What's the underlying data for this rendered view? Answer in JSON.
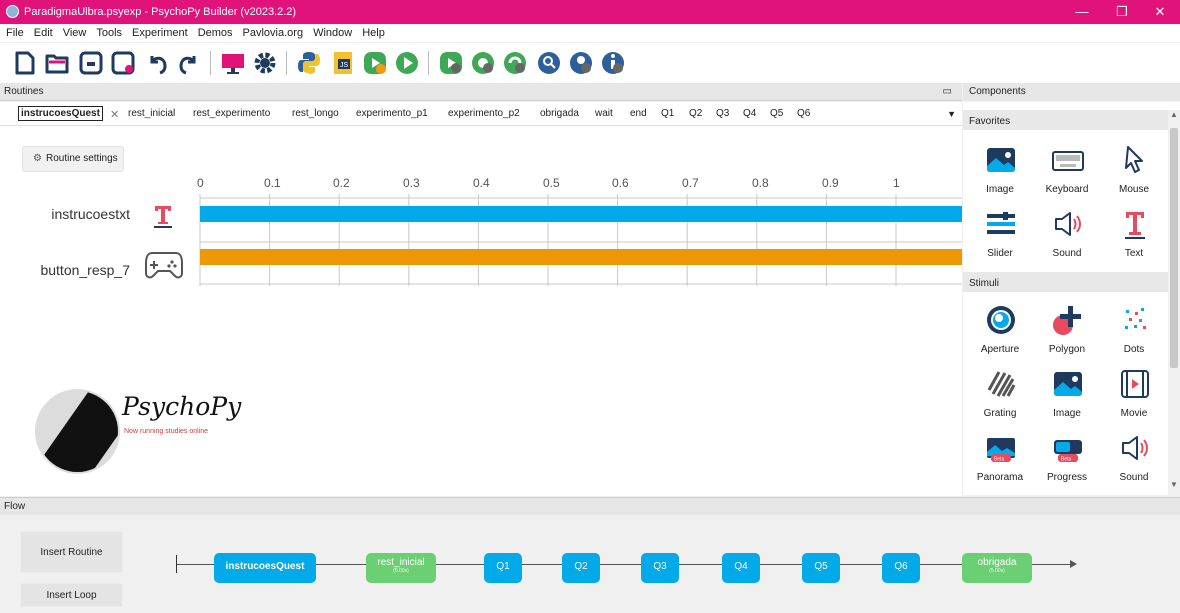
{
  "window": {
    "title": "ParadigmaUlbra.psyexp - PsychoPy Builder (v2023.2.2)",
    "controls": {
      "minimize": "—",
      "maximize": "❐",
      "close": "✕"
    },
    "colors": {
      "titlebar": "#e0137a"
    }
  },
  "menu": [
    "File",
    "Edit",
    "View",
    "Tools",
    "Experiment",
    "Demos",
    "Pavlovia.org",
    "Window",
    "Help"
  ],
  "toolbar": [
    {
      "name": "new-file-icon"
    },
    {
      "name": "open-icon"
    },
    {
      "name": "save-icon"
    },
    {
      "name": "save-as-icon"
    },
    {
      "name": "undo-icon"
    },
    {
      "name": "redo-icon"
    },
    {
      "name": "monitor-icon"
    },
    {
      "name": "settings-gear-icon"
    },
    {
      "name": "compile-python-icon"
    },
    {
      "name": "compile-js-icon"
    },
    {
      "name": "run-pilot-icon"
    },
    {
      "name": "run-icon"
    },
    {
      "name": "pavlovia-sync-icon"
    },
    {
      "name": "pavlovia-pilot-icon"
    },
    {
      "name": "pavlovia-run-icon"
    },
    {
      "name": "pavlovia-search-icon"
    },
    {
      "name": "pavlovia-user-icon"
    },
    {
      "name": "pavlovia-info-icon"
    }
  ],
  "routines": {
    "header": "Routines",
    "maximize_icon": "▭",
    "tabs": [
      "instrucoesQuest",
      "rest_inicial",
      "rest_experimento",
      "rest_longo",
      "experimento_p1",
      "experimento_p2",
      "obrigada",
      "wait",
      "end",
      "Q1",
      "Q2",
      "Q3",
      "Q4",
      "Q5",
      "Q6"
    ],
    "active_tab": "instrucoesQuest",
    "tab_close": "✕",
    "dropdown_icon": "▼",
    "settings_button": "Routine settings",
    "timeline": {
      "ticks": [
        "0",
        "0.1",
        "0.2",
        "0.3",
        "0.4",
        "0.5",
        "0.6",
        "0.7",
        "0.8",
        "0.9",
        "1"
      ],
      "components": [
        {
          "name": "instrucoestxt",
          "icon": "text-icon",
          "color": "#02a9ea"
        },
        {
          "name": "button_resp_7",
          "icon": "gamepad-icon",
          "color": "#ec9703"
        }
      ]
    },
    "logo": {
      "name": "PsychoPy",
      "tagline": "Now running studies online"
    }
  },
  "components": {
    "header": "Components",
    "categories": [
      {
        "name": "Favorites",
        "items": [
          {
            "label": "Image",
            "icon": "image-icon"
          },
          {
            "label": "Keyboard",
            "icon": "keyboard-icon"
          },
          {
            "label": "Mouse",
            "icon": "mouse-pointer-icon"
          },
          {
            "label": "Slider",
            "icon": "slider-icon"
          },
          {
            "label": "Sound",
            "icon": "speaker-icon"
          },
          {
            "label": "Text",
            "icon": "text-icon"
          }
        ]
      },
      {
        "name": "Stimuli",
        "items": [
          {
            "label": "Aperture",
            "icon": "aperture-icon"
          },
          {
            "label": "Polygon",
            "icon": "polygon-icon"
          },
          {
            "label": "Dots",
            "icon": "dots-icon"
          },
          {
            "label": "Grating",
            "icon": "grating-icon"
          },
          {
            "label": "Image",
            "icon": "image-icon"
          },
          {
            "label": "Movie",
            "icon": "movie-icon"
          },
          {
            "label": "Panorama",
            "icon": "panorama-icon",
            "badge": "Beta"
          },
          {
            "label": "Progress",
            "icon": "progress-icon",
            "badge": "Beta"
          },
          {
            "label": "Sound",
            "icon": "speaker-icon"
          }
        ]
      }
    ]
  },
  "flow": {
    "header": "Flow",
    "insert_routine": "Insert Routine",
    "insert_loop": "Insert Loop",
    "nodes": [
      {
        "label": "instrucoesQuest",
        "type": "blue"
      },
      {
        "label": "rest_inicial",
        "sub": "(5.00s)",
        "type": "green"
      },
      {
        "label": "Q1",
        "type": "blue"
      },
      {
        "label": "Q2",
        "type": "blue"
      },
      {
        "label": "Q3",
        "type": "blue"
      },
      {
        "label": "Q4",
        "type": "blue"
      },
      {
        "label": "Q5",
        "type": "blue"
      },
      {
        "label": "Q6",
        "type": "blue"
      },
      {
        "label": "obrigada",
        "sub": "(5.00s)",
        "type": "green"
      }
    ]
  }
}
